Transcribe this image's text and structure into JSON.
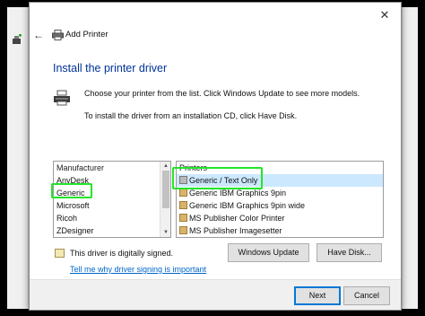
{
  "dialog": {
    "title": "Add Printer",
    "close_glyph": "✕",
    "back_glyph": "←"
  },
  "heading": "Install the printer driver",
  "description": {
    "line1": "Choose your printer from the list. Click Windows Update to see more models.",
    "line2": "To install the driver from an installation CD, click Have Disk."
  },
  "manufacturer_list": {
    "header": "Manufacturer",
    "items": [
      "AnyDesk",
      "Generic",
      "Microsoft",
      "Ricoh",
      "ZDesigner"
    ],
    "selected": "Generic"
  },
  "printers_list": {
    "header": "Printers",
    "items": [
      "Generic / Text Only",
      "Generic IBM Graphics 9pin",
      "Generic IBM Graphics 9pin wide",
      "MS Publisher Color Printer",
      "MS Publisher Imagesetter"
    ],
    "selected": "Generic / Text Only"
  },
  "signature": {
    "text": "This driver is digitally signed.",
    "link": "Tell me why driver signing is important"
  },
  "buttons": {
    "windows_update": "Windows Update",
    "have_disk": "Have Disk...",
    "next": "Next",
    "cancel": "Cancel"
  },
  "colors": {
    "heading": "#003399",
    "highlight": "#21e52a",
    "selection": "#cce8ff",
    "link": "#0066cc"
  }
}
